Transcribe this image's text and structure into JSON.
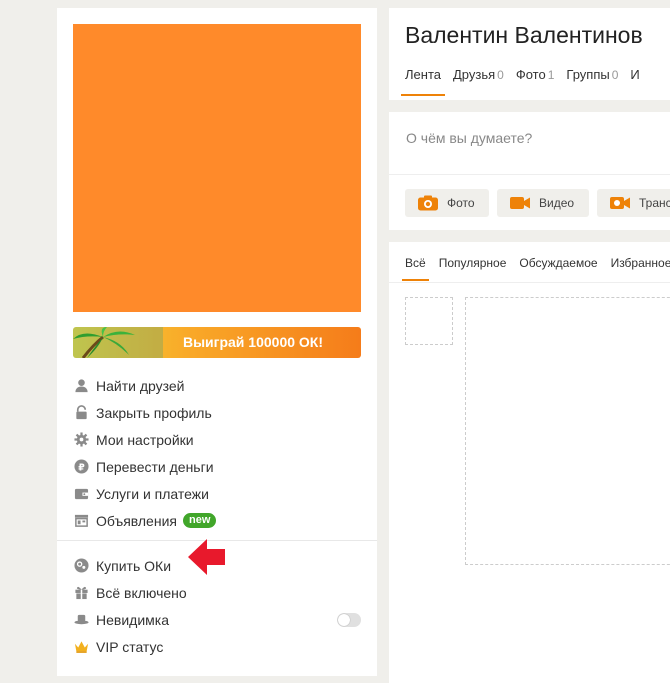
{
  "profile": {
    "name": "Валентин Валентинов",
    "avatar_color": "#ff8a2a",
    "promo_text": "Выиграй 100000 ОК!"
  },
  "menu": {
    "items": [
      {
        "label": "Найти друзей",
        "icon": "person-icon"
      },
      {
        "label": "Закрыть профиль",
        "icon": "lock-icon"
      },
      {
        "label": "Мои настройки",
        "icon": "gear-icon"
      },
      {
        "label": "Перевести деньги",
        "icon": "ruble-icon"
      },
      {
        "label": "Услуги и платежи",
        "icon": "wallet-icon"
      },
      {
        "label": "Объявления",
        "icon": "ads-icon",
        "badge": "new"
      }
    ],
    "items2": [
      {
        "label": "Купить ОКи",
        "icon": "ok-coin-icon"
      },
      {
        "label": "Всё включено",
        "icon": "gift-icon"
      },
      {
        "label": "Невидимка",
        "icon": "hat-icon",
        "toggle": false
      },
      {
        "label": "VIP статус",
        "icon": "crown-icon"
      }
    ]
  },
  "tabs": [
    {
      "label": "Лента",
      "count": ""
    },
    {
      "label": "Друзья",
      "count": "0"
    },
    {
      "label": "Фото",
      "count": "1"
    },
    {
      "label": "Группы",
      "count": "0"
    },
    {
      "label": "И",
      "count": ""
    }
  ],
  "composer": {
    "placeholder": "О чём вы думаете?",
    "buttons": [
      {
        "label": "Фото",
        "icon": "camera-icon"
      },
      {
        "label": "Видео",
        "icon": "video-icon"
      },
      {
        "label": "Транс",
        "icon": "broadcast-icon"
      }
    ]
  },
  "feed_tabs": [
    "Всё",
    "Популярное",
    "Обсуждаемое",
    "Избранное"
  ],
  "colors": {
    "accent": "#ee8208",
    "badge": "#41a62a",
    "arrow": "#e8192c"
  }
}
